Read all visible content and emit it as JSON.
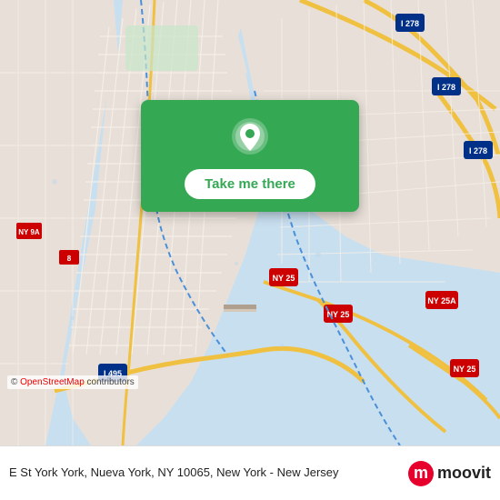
{
  "map": {
    "alt": "Map of New York City showing Manhattan and surrounding areas"
  },
  "card": {
    "pin_icon_alt": "location pin",
    "button_label": "Take me there"
  },
  "attribution": {
    "prefix": "© ",
    "link_text": "OpenStreetMap",
    "suffix": " contributors"
  },
  "info_bar": {
    "address": "E St York York, Nueva York, NY 10065, New York - New Jersey"
  },
  "moovit": {
    "logo_letter": "m",
    "logo_text": "moovit"
  }
}
